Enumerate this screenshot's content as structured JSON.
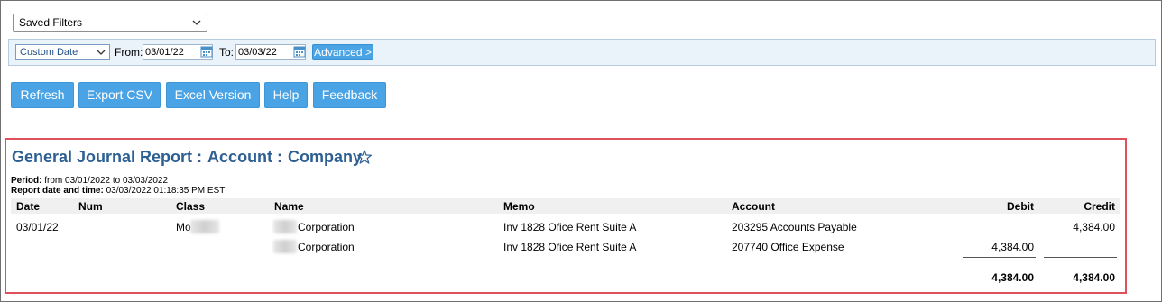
{
  "saved_filters": {
    "label": "Saved Filters"
  },
  "filter_bar": {
    "date_range": "Custom Date",
    "from_label": "From:",
    "from_value": "03/01/22",
    "to_label": "To:",
    "to_value": "03/03/22",
    "advanced_label": "Advanced >"
  },
  "actions": {
    "refresh": "Refresh",
    "export_csv": "Export CSV",
    "excel": "Excel Version",
    "help": "Help",
    "feedback": "Feedback"
  },
  "report": {
    "title": "General Journal Report :",
    "account": "Account :",
    "company": "Company",
    "period_label": "Period:",
    "period_value": "from 03/01/2022 to 03/03/2022",
    "datetime_label": "Report date and time:",
    "datetime_value": "03/03/2022 01:18:35 PM EST",
    "columns": [
      "Date",
      "Num",
      "Class",
      "Name",
      "Memo",
      "Account",
      "Debit",
      "Credit"
    ],
    "rows": [
      {
        "date": "03/01/22",
        "num": "",
        "class": "Mo",
        "name": "Corporation",
        "memo": "Inv 1828 Ofice Rent Suite A",
        "account": "203295 Accounts Payable",
        "debit": "",
        "credit": "4,384.00"
      },
      {
        "date": "",
        "num": "",
        "class": "",
        "name": "Corporation",
        "memo": "Inv 1828 Ofice Rent Suite A",
        "account": "207740 Office Expense",
        "debit": "4,384.00",
        "credit": ""
      }
    ],
    "totals": {
      "debit": "4,384.00",
      "credit": "4,384.00"
    }
  },
  "colors": {
    "accent": "#4aa3e4",
    "title": "#2d5f93",
    "highlight": "#e0505a"
  }
}
